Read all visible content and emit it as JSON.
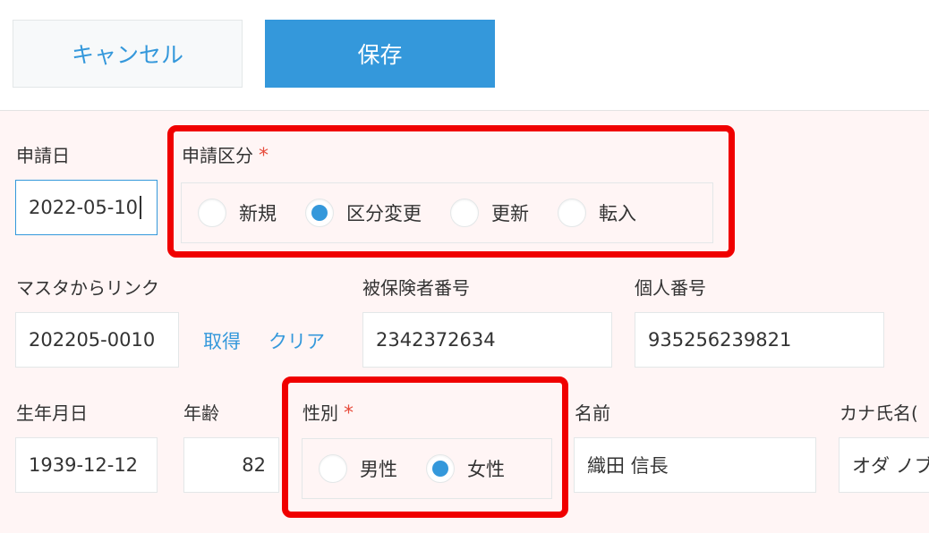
{
  "toolbar": {
    "cancel_label": "キャンセル",
    "save_label": "保存"
  },
  "form": {
    "application_date": {
      "label": "申請日",
      "value": "2022-05-10"
    },
    "application_type": {
      "label": "申請区分",
      "required_mark": "*",
      "options": [
        "新規",
        "区分変更",
        "更新",
        "転入"
      ],
      "selected": "区分変更"
    },
    "master_link": {
      "label": "マスタからリンク",
      "value": "202205-0010",
      "get_link": "取得",
      "clear_link": "クリア"
    },
    "insured_number": {
      "label": "被保険者番号",
      "value": "2342372634"
    },
    "personal_number": {
      "label": "個人番号",
      "value": "935256239821"
    },
    "birth_date": {
      "label": "生年月日",
      "value": "1939-12-12"
    },
    "age": {
      "label": "年齢",
      "value": "82"
    },
    "gender": {
      "label": "性別",
      "required_mark": "*",
      "options": [
        "男性",
        "女性"
      ],
      "selected": "女性"
    },
    "name": {
      "label": "名前",
      "value": "織田 信長"
    },
    "kana_name": {
      "label": "カナ氏名(",
      "value": "オダ ノブ"
    }
  },
  "colors": {
    "accent": "#3498db",
    "required": "#e74c3c",
    "highlight": "#f00000",
    "form_background": "#fff5f5"
  }
}
